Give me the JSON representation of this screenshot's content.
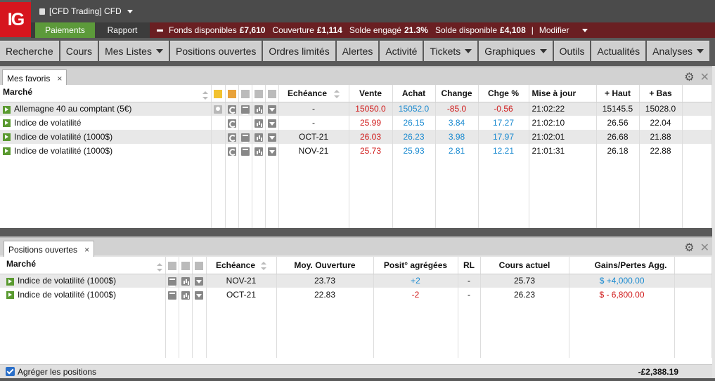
{
  "header": {
    "logo": "IG",
    "account": "[CFD Trading] CFD",
    "paiements": "Paiements",
    "rapport": "Rapport",
    "funds_label": "Fonds disponibles",
    "funds_value": "£7,610",
    "couverture_label": "Couverture",
    "couverture_value": "£1,114",
    "solde_engage_label": "Solde engagé",
    "solde_engage_value": "21.3%",
    "solde_dispo_label": "Solde disponible",
    "solde_dispo_value": "£4,108",
    "sep": "|",
    "modifier": "Modifier"
  },
  "menu": [
    {
      "label": "Recherche",
      "dropdown": false
    },
    {
      "label": "Cours",
      "dropdown": false
    },
    {
      "label": "Mes Listes",
      "dropdown": true
    },
    {
      "label": "Positions ouvertes",
      "dropdown": false
    },
    {
      "label": "Ordres limités",
      "dropdown": false
    },
    {
      "label": "Alertes",
      "dropdown": false
    },
    {
      "label": "Activité",
      "dropdown": false
    },
    {
      "label": "Tickets",
      "dropdown": true
    },
    {
      "label": "Graphiques",
      "dropdown": true
    },
    {
      "label": "Outils",
      "dropdown": false
    },
    {
      "label": "Actualités",
      "dropdown": false
    },
    {
      "label": "Analyses",
      "dropdown": true
    }
  ],
  "favoris": {
    "tab": "Mes favoris",
    "close": "×",
    "cols": {
      "marche": "Marché",
      "echeance": "Echéance",
      "vente": "Vente",
      "achat": "Achat",
      "change": "Change",
      "chge": "Chge %",
      "maj": "Mise à jour",
      "haut": "+ Haut",
      "bas": "+ Bas"
    },
    "rows": [
      {
        "marche": "Allemagne 40 au comptant (5€)",
        "echeance": "-",
        "vente": "15050.0",
        "achat": "15052.0",
        "change": "-85.0",
        "chge": "-0.56",
        "maj": "21:02:22",
        "haut": "15145.5",
        "bas": "15028.0",
        "bulb": true,
        "news": true,
        "neg": true
      },
      {
        "marche": "Indice de volatilité",
        "echeance": "-",
        "vente": "25.99",
        "achat": "26.15",
        "change": "3.84",
        "chge": "17.27",
        "maj": "21:02:10",
        "haut": "26.56",
        "bas": "22.04",
        "bulb": false,
        "news": false,
        "neg": false
      },
      {
        "marche": "Indice de volatilité (1000$)",
        "echeance": "OCT-21",
        "vente": "26.03",
        "achat": "26.23",
        "change": "3.98",
        "chge": "17.97",
        "maj": "21:02:01",
        "haut": "26.68",
        "bas": "21.88",
        "bulb": false,
        "news": true,
        "neg": false
      },
      {
        "marche": "Indice de volatilité (1000$)",
        "echeance": "NOV-21",
        "vente": "25.73",
        "achat": "25.93",
        "change": "2.81",
        "chge": "12.21",
        "maj": "21:01:31",
        "haut": "26.18",
        "bas": "22.88",
        "bulb": false,
        "news": true,
        "neg": false
      }
    ]
  },
  "positions": {
    "tab": "Positions ouvertes",
    "close": "×",
    "cols": {
      "marche": "Marché",
      "echeance": "Echéance",
      "moy": "Moy. Ouverture",
      "posit": "Posit° agrégées",
      "rl": "RL",
      "cours": "Cours actuel",
      "gains": "Gains/Pertes Agg."
    },
    "rows": [
      {
        "marche": "Indice de volatilité (1000$)",
        "echeance": "NOV-21",
        "moy": "23.73",
        "posit": "+2",
        "rl": "-",
        "cours": "25.73",
        "gains": "$ +4,000.00",
        "pos": true
      },
      {
        "marche": "Indice de volatilité (1000$)",
        "echeance": "OCT-21",
        "moy": "22.83",
        "posit": "-2",
        "rl": "-",
        "cours": "26.23",
        "gains": "$ - 6,800.00",
        "pos": false
      }
    ],
    "footer_label": "Agréger les positions",
    "total": "-£2,388.19"
  }
}
